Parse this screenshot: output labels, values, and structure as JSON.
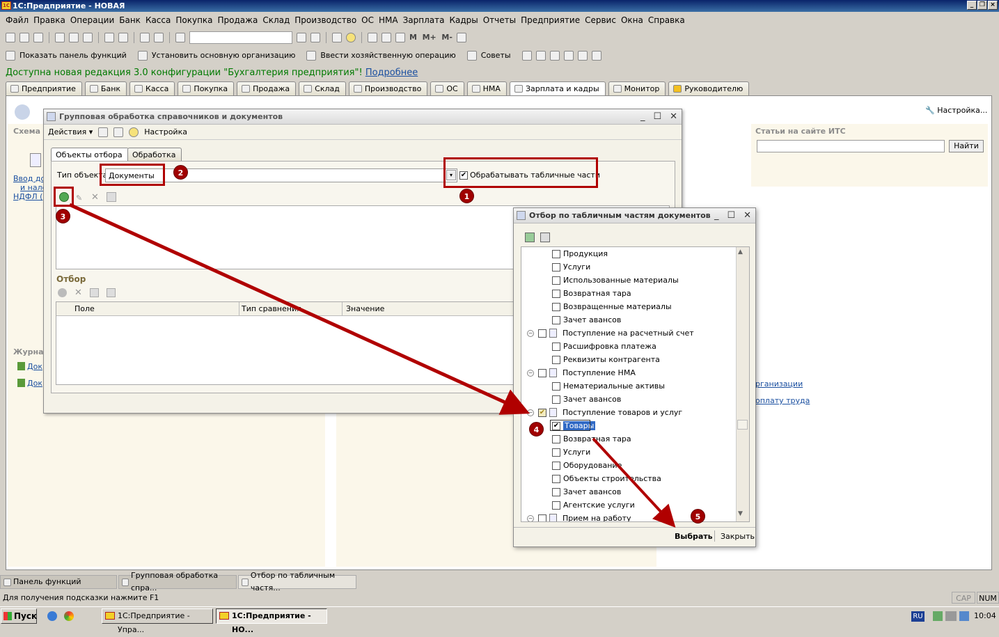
{
  "window": {
    "title": "1С:Предприятие - НОВАЯ"
  },
  "menu": [
    "Файл",
    "Правка",
    "Операции",
    "Банк",
    "Касса",
    "Покупка",
    "Продажа",
    "Склад",
    "Производство",
    "ОС",
    "НМА",
    "Зарплата",
    "Кадры",
    "Отчеты",
    "Предприятие",
    "Сервис",
    "Окна",
    "Справка"
  ],
  "toolbar2": {
    "show_panel": "Показать панель функций",
    "set_org": "Установить основную организацию",
    "enter_op": "Ввести хозяйственную операцию",
    "tips": "Советы"
  },
  "notice": {
    "text": "Доступна новая редакция 3.0 конфигурации \"Бухгалтерия предприятия\"!",
    "link": "Подробнее"
  },
  "tabs": [
    "Предприятие",
    "Банк",
    "Касса",
    "Покупка",
    "Продажа",
    "Склад",
    "Производство",
    "ОС",
    "НМА",
    "Зарплата и кадры",
    "Монитор",
    "Руководителю"
  ],
  "background": {
    "scheme": "Схема",
    "journals": "Журна",
    "its_title": "Статьи на сайте ИТС",
    "its_button": "Найти",
    "settings": "Настройка...",
    "link1": "Ввод до",
    "link2": "и нало",
    "link3": "НДФЛ (",
    "doc1": "Док",
    "doc2": "Док",
    "right_link1": "рганизации",
    "right_link2": "оплату труда"
  },
  "dialog1": {
    "title": "Групповая обработка справочников и документов",
    "actions": "Действия",
    "settings": "Настройка",
    "tab_objects": "Объекты отбора",
    "tab_processing": "Обработка",
    "type_label": "Тип объекта:",
    "type_value": "Документы",
    "process_tables": "Обрабатывать табличные части",
    "filter_label": "Отбор",
    "col_field": "Поле",
    "col_compare": "Тип сравнения",
    "col_value": "Значение"
  },
  "dialog2": {
    "title": "Отбор по табличным частям документов",
    "rows": [
      {
        "label": "Продукция",
        "level": 1,
        "checked": false
      },
      {
        "label": "Услуги",
        "level": 1,
        "checked": false
      },
      {
        "label": "Использованные материалы",
        "level": 1,
        "checked": false
      },
      {
        "label": "Возвратная тара",
        "level": 1,
        "checked": false
      },
      {
        "label": "Возвращенные материалы",
        "level": 1,
        "checked": false
      },
      {
        "label": "Зачет авансов",
        "level": 1,
        "checked": false
      },
      {
        "label": "Поступление на расчетный счет",
        "level": 0,
        "checked": false
      },
      {
        "label": "Расшифровка платежа",
        "level": 1,
        "checked": false
      },
      {
        "label": "Реквизиты контрагента",
        "level": 1,
        "checked": false
      },
      {
        "label": "Поступление НМА",
        "level": 0,
        "checked": false
      },
      {
        "label": "Нематериальные активы",
        "level": 1,
        "checked": false
      },
      {
        "label": "Зачет авансов",
        "level": 1,
        "checked": false
      },
      {
        "label": "Поступление товаров и услуг",
        "level": 0,
        "checked": true
      },
      {
        "label": "Товары",
        "level": 1,
        "checked": true
      },
      {
        "label": "Возвратная тара",
        "level": 1,
        "checked": false
      },
      {
        "label": "Услуги",
        "level": 1,
        "checked": false
      },
      {
        "label": "Оборудование",
        "level": 1,
        "checked": false
      },
      {
        "label": "Объекты строительства",
        "level": 1,
        "checked": false
      },
      {
        "label": "Зачет авансов",
        "level": 1,
        "checked": false
      },
      {
        "label": "Агентские услуги",
        "level": 1,
        "checked": false
      },
      {
        "label": "Прием на работу",
        "level": 0,
        "checked": false
      }
    ],
    "select": "Выбрать",
    "close": "Закрыть"
  },
  "badges": [
    "1",
    "2",
    "3",
    "4",
    "5"
  ],
  "open_windows": [
    "Панель функций",
    "Групповая обработка спра...",
    "Отбор по табличным частя..."
  ],
  "status": {
    "hint": "Для получения подсказки нажмите F1",
    "cap": "CAP",
    "num": "NUM"
  },
  "taskbar": {
    "start": "Пуск",
    "task1": "1С:Предприятие - Упра...",
    "task2": "1С:Предприятие - НО...",
    "lang": "RU",
    "time": "10:04"
  },
  "colors": {
    "annotation": "#b00000",
    "notice": "#007a00",
    "titlebar": "#0a246a"
  }
}
